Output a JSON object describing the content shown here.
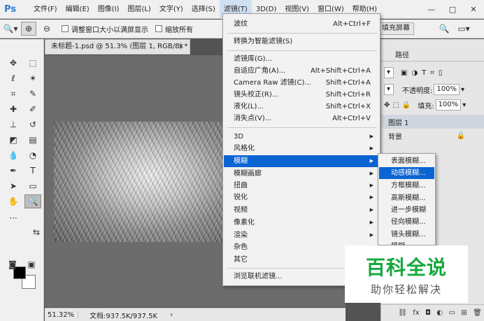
{
  "app": {
    "logo": "Ps"
  },
  "menubar": {
    "items": [
      "文件(F)",
      "编辑(E)",
      "图像(I)",
      "图层(L)",
      "文字(Y)",
      "选择(S)",
      "滤镜(T)",
      "3D(D)",
      "视图(V)",
      "窗口(W)",
      "帮助(H)"
    ],
    "active_index": 6
  },
  "window_controls": [
    "—",
    "□",
    "✕"
  ],
  "options": {
    "check1": "调整窗口大小以满屏显示",
    "check2": "缩放所有",
    "fill_screen": "填充屏幕"
  },
  "document": {
    "tab_title": "未标题-1.psd @ 51.3% (图层 1, RGB/8) *",
    "close": "×",
    "zoom": "51.32%",
    "doc_size": "文档:937.5K/937.5K",
    "arrow": "›"
  },
  "right_panel": {
    "tab_paths": "路径",
    "opacity_label": "不透明度:",
    "opacity_value": "100%",
    "fill_label": "填充:",
    "fill_value": "100%",
    "layers": [
      "图层 1",
      "背景"
    ]
  },
  "filter_menu": {
    "items": [
      {
        "label": "波纹",
        "shortcut": "Alt+Ctrl+F"
      },
      {
        "label": "转换为智能滤镜(S)",
        "shortcut": ""
      },
      {
        "label": "滤镜库(G)...",
        "shortcut": ""
      },
      {
        "label": "自适应广角(A)...",
        "shortcut": "Alt+Shift+Ctrl+A"
      },
      {
        "label": "Camera Raw 滤镜(C)...",
        "shortcut": "Shift+Ctrl+A"
      },
      {
        "label": "镜头校正(R)...",
        "shortcut": "Shift+Ctrl+R"
      },
      {
        "label": "液化(L)...",
        "shortcut": "Shift+Ctrl+X"
      },
      {
        "label": "消失点(V)...",
        "shortcut": "Alt+Ctrl+V"
      },
      {
        "label": "3D",
        "shortcut": ""
      },
      {
        "label": "风格化",
        "shortcut": ""
      },
      {
        "label": "模糊",
        "shortcut": ""
      },
      {
        "label": "模糊画廊",
        "shortcut": ""
      },
      {
        "label": "扭曲",
        "shortcut": ""
      },
      {
        "label": "锐化",
        "shortcut": ""
      },
      {
        "label": "视频",
        "shortcut": ""
      },
      {
        "label": "像素化",
        "shortcut": ""
      },
      {
        "label": "渲染",
        "shortcut": ""
      },
      {
        "label": "杂色",
        "shortcut": ""
      },
      {
        "label": "其它",
        "shortcut": ""
      },
      {
        "label": "浏览联机滤镜...",
        "shortcut": ""
      }
    ],
    "highlighted": "模糊"
  },
  "blur_submenu": {
    "items": [
      "表面模糊...",
      "动感模糊...",
      "方框模糊...",
      "高斯模糊...",
      "进一步模糊",
      "径向模糊...",
      "镜头模糊...",
      "模糊"
    ],
    "highlighted": "动感模糊..."
  },
  "watermark": {
    "title": "百科全说",
    "subtitle": "助你轻松解决"
  },
  "colors": {
    "menu_highlight": "#0a64d2",
    "watermark_green": "#14a83c",
    "foreground": "#000000",
    "background": "#ffffff"
  }
}
